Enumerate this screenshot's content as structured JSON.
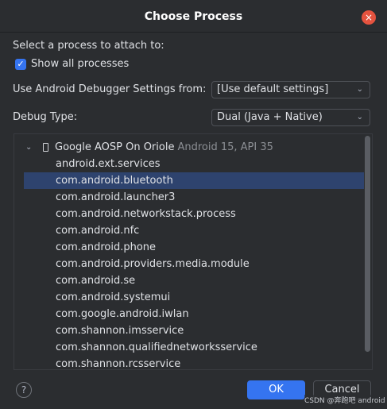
{
  "dialog": {
    "title": "Choose Process",
    "close_label": "×"
  },
  "form": {
    "attach_label": "Select a process to attach to:",
    "show_all_label": "Show all processes",
    "show_all_checked": true,
    "debugger_settings_label": "Use Android Debugger Settings from:",
    "debugger_settings_value": "[Use default settings]",
    "debug_type_label": "Debug Type:",
    "debug_type_value": "Dual (Java + Native)"
  },
  "device": {
    "name": "Google AOSP On Oriole",
    "meta": "Android 15, API 35",
    "expanded": true
  },
  "processes": [
    "android.ext.services",
    "com.android.bluetooth",
    "com.android.launcher3",
    "com.android.networkstack.process",
    "com.android.nfc",
    "com.android.phone",
    "com.android.providers.media.module",
    "com.android.se",
    "com.android.systemui",
    "com.google.android.iwlan",
    "com.shannon.imsservice",
    "com.shannon.qualifiednetworksservice",
    "com.shannon.rcsservice"
  ],
  "selected_process": "com.android.bluetooth",
  "buttons": {
    "help": "?",
    "ok": "OK",
    "cancel": "Cancel"
  },
  "watermark": "CSDN @奔跑吧 android",
  "colors": {
    "background": "#2b2d30",
    "accent": "#3574f0",
    "selection": "#2e436e",
    "close": "#e5533f"
  }
}
